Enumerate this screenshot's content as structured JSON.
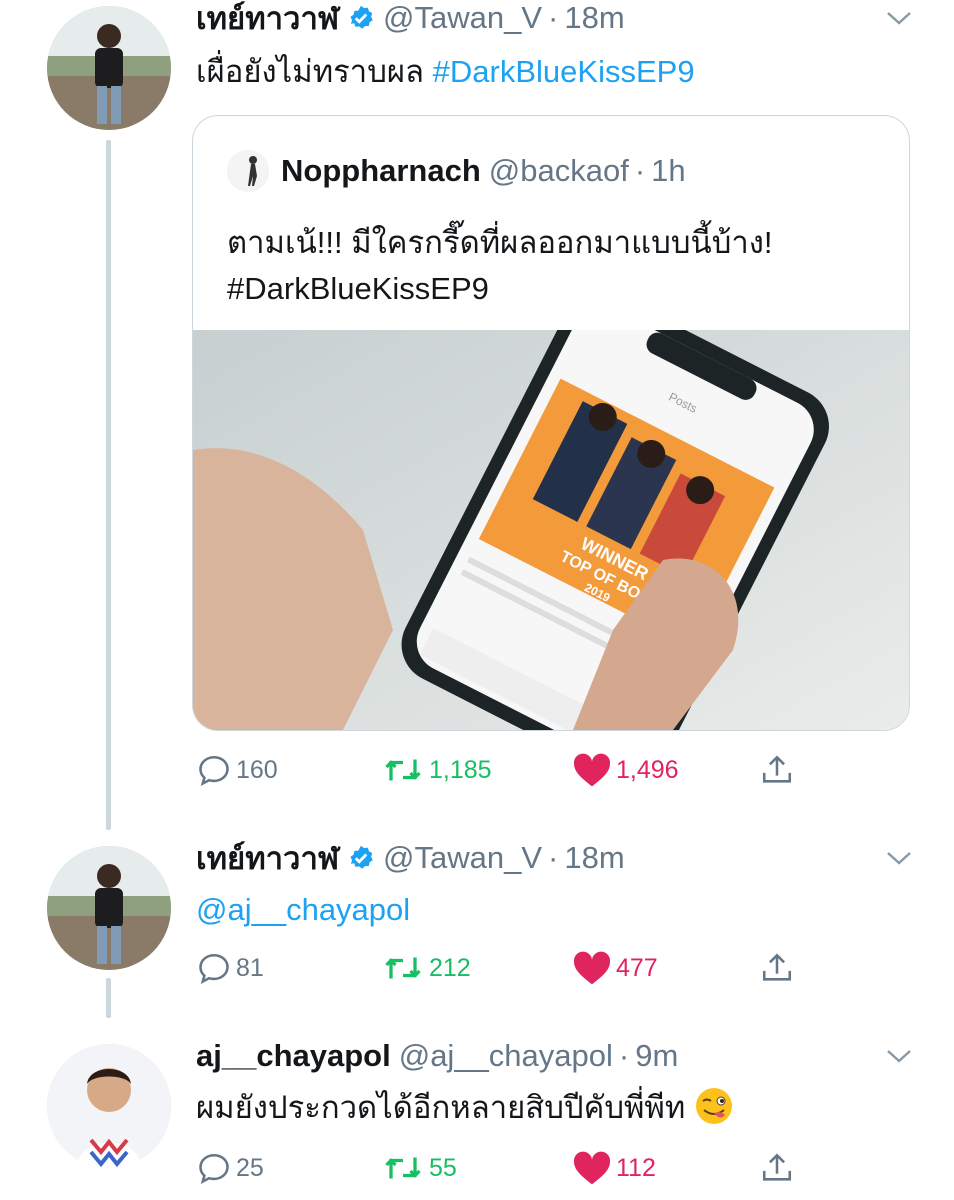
{
  "tweets": [
    {
      "name": "เทย์ทาวาฬ",
      "handle": "@Tawan_V",
      "time": "18m",
      "text": "เผื่อยังไม่ทราบผล",
      "hashtag": "#DarkBlueKissEP9",
      "stats": {
        "replies": "160",
        "retweets": "1,185",
        "likes": "1,496"
      },
      "quoted": {
        "name": "Noppharnach",
        "handle": "@backaof",
        "time": "1h",
        "line1": "ตามเน้!!! มีใครกรี๊ดที่ผลออกมาแบบนี้บ้าง!",
        "line2": "#DarkBlueKissEP9",
        "media_text": {
          "winner": "WINNER",
          "award": "TOP OF BOY",
          "year": "2019",
          "posts": "Posts"
        }
      }
    },
    {
      "name": "เทย์ทาวาฬ",
      "handle": "@Tawan_V",
      "time": "18m",
      "text": "@aj__chayapol",
      "stats": {
        "replies": "81",
        "retweets": "212",
        "likes": "477"
      }
    },
    {
      "name": "aj__chayapol",
      "handle": "@aj__chayapol",
      "time": "9m",
      "text": "ผมยังประกวดได้อีกหลายสิบปีคับพี่พีท",
      "stats": {
        "replies": "25",
        "retweets": "55",
        "likes": "112"
      }
    }
  ],
  "separator": "·",
  "icons": [
    "verified-badge-icon",
    "chevron-down-icon",
    "reply-icon",
    "retweet-icon",
    "like-heart-icon",
    "share-icon",
    "winking-tongue-emoji-icon"
  ],
  "colors": {
    "link": "#1da1f2",
    "meta": "#657786",
    "retweet": "#17bf63",
    "like": "#e0245e",
    "thread_line": "#ccd6dd"
  }
}
